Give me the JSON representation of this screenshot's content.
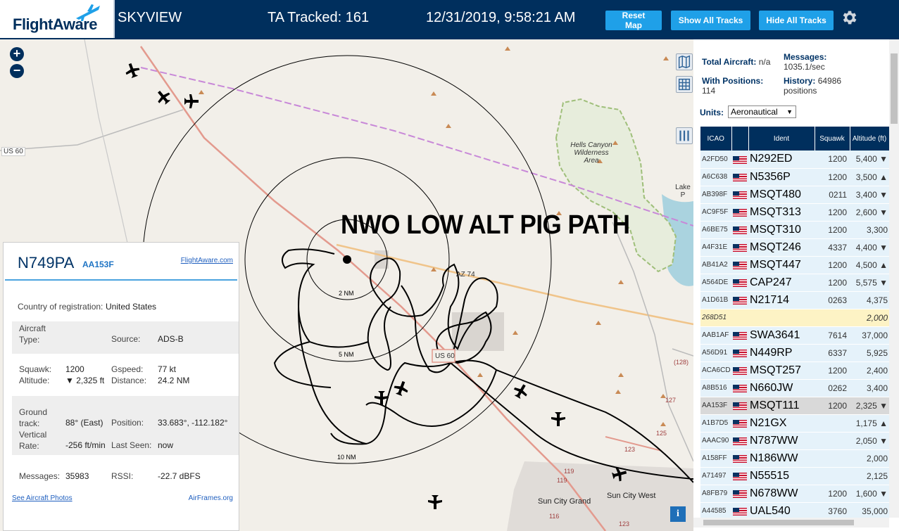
{
  "header": {
    "logo_text": "FlightAware",
    "app_name": "SKYVIEW",
    "tracked_label": "TA Tracked: 161",
    "datetime": "12/31/2019, 9:58:21 AM",
    "buttons": {
      "reset": "Reset Map",
      "show_all": "Show All Tracks",
      "hide_all": "Hide All Tracks"
    }
  },
  "map": {
    "zoom_in": "+",
    "zoom_out": "−",
    "annotation": "NWO LOW ALT PIG PATH",
    "rings": [
      "2 NM",
      "5 NM",
      "10 NM"
    ],
    "labels": {
      "wilderness": "Hells Canyon Wilderness Area",
      "lake": "Lake P",
      "az74": "AZ 74",
      "us60_left": "US 60",
      "us60_mid": "US 60",
      "sun_city_grand": "Sun City Grand",
      "sun_city_west": "Sun City West",
      "r128": "(128)",
      "r127": "127",
      "r125": "125",
      "r123": "123",
      "r119a": "119",
      "r119b": "119",
      "r116": "116",
      "r123b": "123"
    },
    "info_button": "i"
  },
  "selected": {
    "ident": "N749PA",
    "icao": "AA153F",
    "fa_link": "FlightAware.com",
    "country_label": "Country of registration:",
    "country_value": "United States",
    "aircraft_type_label": "Aircraft Type:",
    "aircraft_type_value": "",
    "source_label": "Source:",
    "source_value": "ADS-B",
    "squawk_label": "Squawk:",
    "squawk_value": "1200",
    "altitude_label": "Altitude:",
    "altitude_value": "▼ 2,325 ft",
    "gspeed_label": "Gspeed:",
    "gspeed_value": "77 kt",
    "distance_label": "Distance:",
    "distance_value": "24.2 NM",
    "track_label": "Ground track:",
    "track_value": "88° (East)",
    "position_label": "Position:",
    "position_value": "33.683°, -112.182°",
    "vrate_label": "Vertical Rate:",
    "vrate_value": "-256 ft/min",
    "lastseen_label": "Last Seen:",
    "lastseen_value": "now",
    "messages_label": "Messages:",
    "messages_value": "35983",
    "rssi_label": "RSSI:",
    "rssi_value": "-22.7 dBFS",
    "photos_link": "See Aircraft Photos",
    "airframes_link": "AirFrames.org"
  },
  "stats": {
    "total_label": "Total Aircraft:",
    "total_value": "n/a",
    "messages_label": "Messages:",
    "messages_value": "1035.1/sec",
    "positions_label": "With Positions:",
    "positions_value": "114",
    "history_label": "History:",
    "history_value": "64986",
    "history_unit": "positions",
    "units_label": "Units:",
    "units_value": "Aeronautical"
  },
  "table": {
    "headers": {
      "icao": "ICAO",
      "flag": "",
      "ident": "Ident",
      "squawk": "Squawk",
      "altitude": "Altitude (ft)"
    },
    "rows": [
      {
        "icao": "A2FD50",
        "ident": "N292ED",
        "squawk": "1200",
        "alt": "5,400 ▼",
        "flag": true
      },
      {
        "icao": "A6C638",
        "ident": "N5356P",
        "squawk": "1200",
        "alt": "3,500 ▲",
        "flag": true
      },
      {
        "icao": "AB398F",
        "ident": "MSQT480",
        "squawk": "0211",
        "alt": "3,400 ▼",
        "flag": true
      },
      {
        "icao": "AC9F5F",
        "ident": "MSQT313",
        "squawk": "1200",
        "alt": "2,600 ▼",
        "flag": true
      },
      {
        "icao": "A6BE75",
        "ident": "MSQT310",
        "squawk": "1200",
        "alt": "3,300",
        "flag": true
      },
      {
        "icao": "A4F31E",
        "ident": "MSQT246",
        "squawk": "4337",
        "alt": "4,400 ▼",
        "flag": true
      },
      {
        "icao": "AB41A2",
        "ident": "MSQT447",
        "squawk": "1200",
        "alt": "4,500 ▲",
        "flag": true
      },
      {
        "icao": "A564DE",
        "ident": "CAP247",
        "squawk": "1200",
        "alt": "5,575 ▼",
        "flag": true
      },
      {
        "icao": "A1D61B",
        "ident": "N21714",
        "squawk": "0263",
        "alt": "4,375",
        "flag": true
      },
      {
        "icao": "268D51",
        "ident": "",
        "squawk": "",
        "alt": "2,000",
        "flag": false
      },
      {
        "icao": "AAB1AF",
        "ident": "SWA3641",
        "squawk": "7614",
        "alt": "37,000",
        "flag": true
      },
      {
        "icao": "A56D91",
        "ident": "N449RP",
        "squawk": "6337",
        "alt": "5,925",
        "flag": true
      },
      {
        "icao": "ACA6CD",
        "ident": "MSQT257",
        "squawk": "1200",
        "alt": "2,400",
        "flag": true
      },
      {
        "icao": "A8B516",
        "ident": "N660JW",
        "squawk": "0262",
        "alt": "3,400",
        "flag": true
      },
      {
        "icao": "AA153F",
        "ident": "MSQT111",
        "squawk": "1200",
        "alt": "2,325 ▼",
        "flag": true,
        "selected": true
      },
      {
        "icao": "A1B7D5",
        "ident": "N21GX",
        "squawk": "",
        "alt": "1,175 ▲",
        "flag": true
      },
      {
        "icao": "AAAC90",
        "ident": "N787WW",
        "squawk": "",
        "alt": "2,050 ▼",
        "flag": true
      },
      {
        "icao": "A158FF",
        "ident": "N186WW",
        "squawk": "",
        "alt": "2,000",
        "flag": true
      },
      {
        "icao": "A71497",
        "ident": "N55515",
        "squawk": "",
        "alt": "2,125",
        "flag": true
      },
      {
        "icao": "A8FB79",
        "ident": "N678WW",
        "squawk": "1200",
        "alt": "1,600 ▼",
        "flag": true
      },
      {
        "icao": "A44585",
        "ident": "UAL540",
        "squawk": "3760",
        "alt": "35,000",
        "flag": true
      }
    ]
  }
}
